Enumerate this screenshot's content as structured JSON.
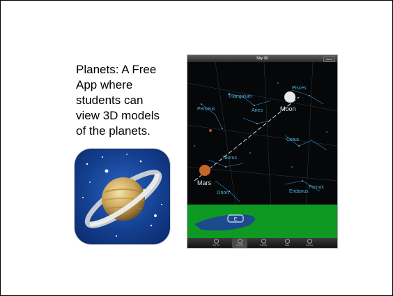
{
  "slide": {
    "caption": "Planets: A Free\nApp where\nstudents can\nview 3D models\nof the planets."
  },
  "app_icon": {
    "icon": "saturn-icon"
  },
  "screenshot": {
    "title": "Sky 3D",
    "top_button": "Home",
    "constellations": [
      "Triangulum",
      "Pisces",
      "Perseus",
      "Aries",
      "Cetus",
      "Taurus",
      "Orion",
      "Eridanus",
      "Fornax"
    ],
    "planets": [
      "Moon",
      "Mars"
    ],
    "tabs": [
      {
        "label": "Sky 2D",
        "icon": "sky2d-icon"
      },
      {
        "label": "Sky 3D",
        "icon": "sky3d-icon",
        "active": true
      },
      {
        "label": "Visibility",
        "icon": "visibility-icon"
      },
      {
        "label": "Data",
        "icon": "data-icon"
      },
      {
        "label": "Options",
        "icon": "options-icon"
      }
    ]
  }
}
